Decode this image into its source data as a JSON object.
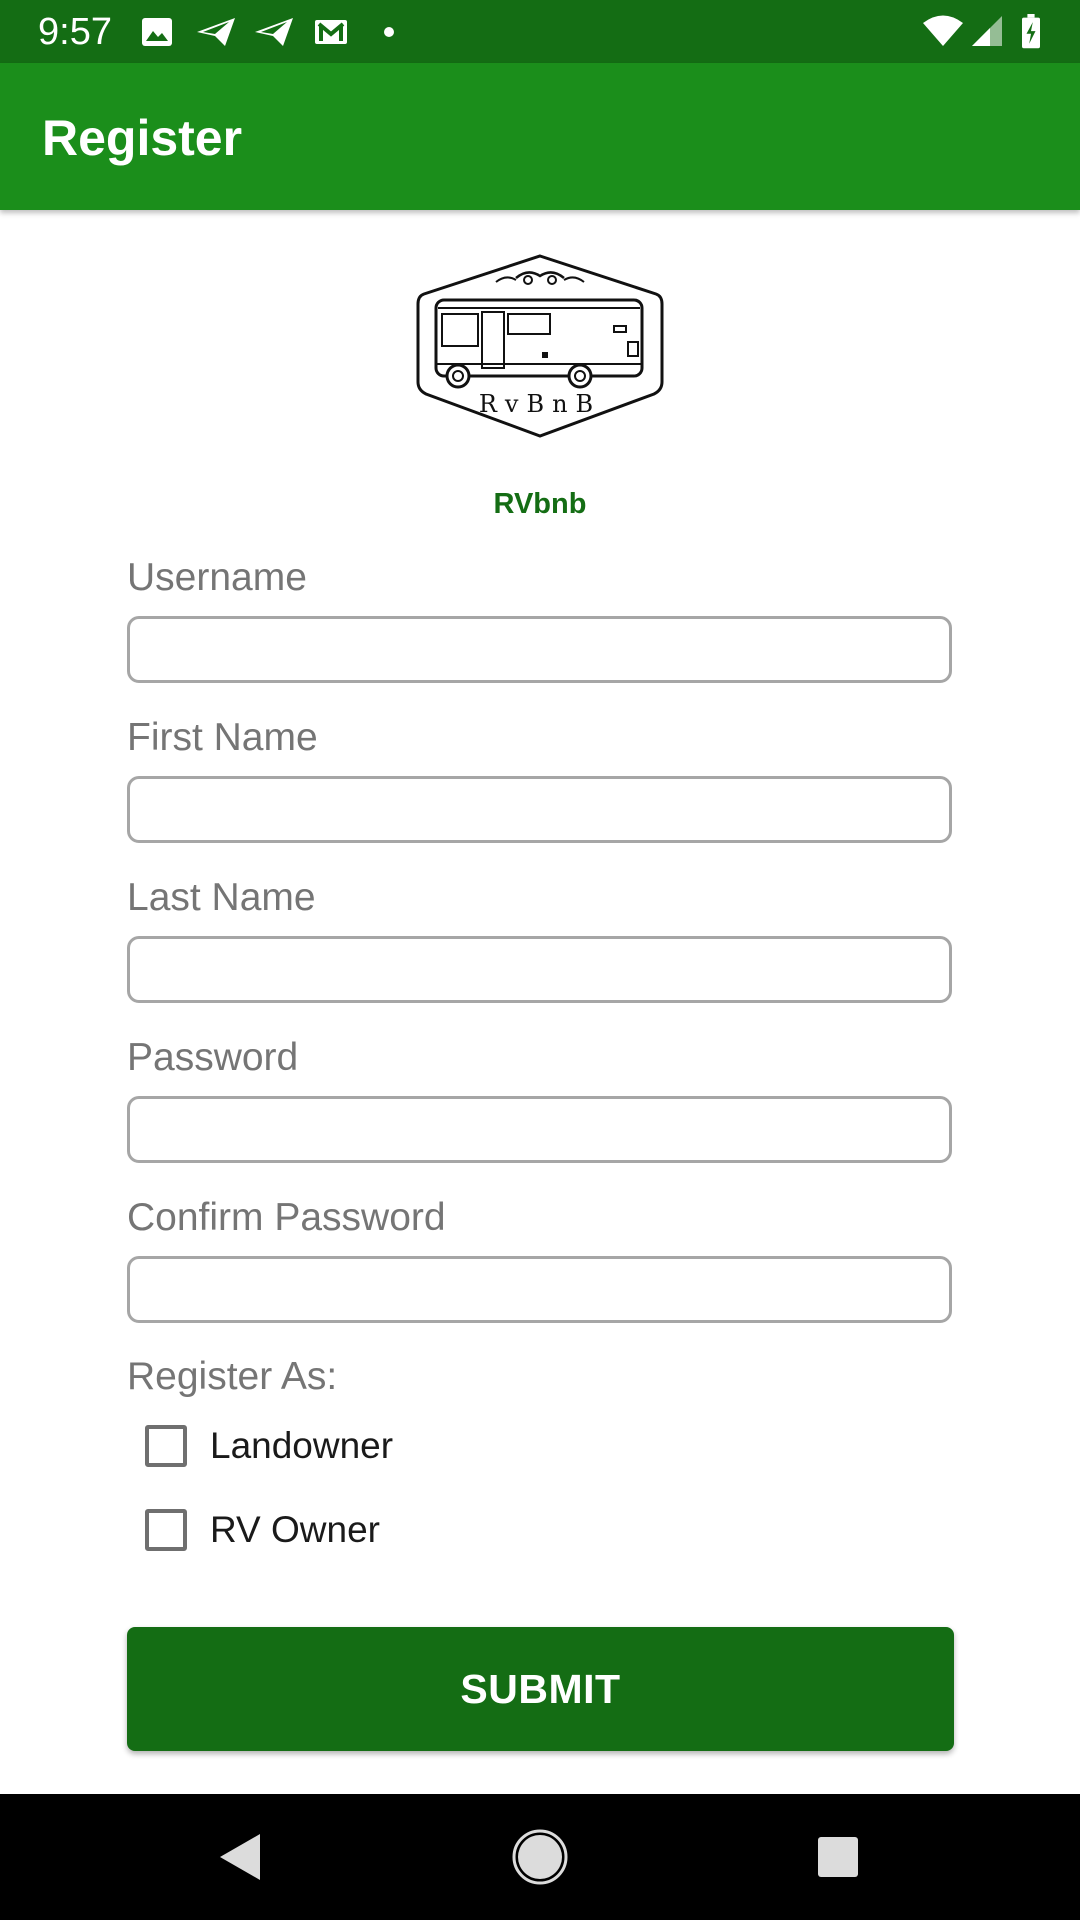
{
  "status_bar": {
    "time": "9:57",
    "left_icons": [
      "image-icon",
      "send-icon",
      "send-icon",
      "gmail-icon",
      "dot-icon"
    ],
    "right_icons": [
      "wifi-icon",
      "cell-signal-icon",
      "battery-charging-icon"
    ]
  },
  "app_bar": {
    "title": "Register"
  },
  "logo": {
    "text": "RvBnB",
    "icon": "rv-camper-logo"
  },
  "brand": {
    "name": "RVbnb"
  },
  "form": {
    "username": {
      "label": "Username",
      "value": ""
    },
    "first_name": {
      "label": "First Name",
      "value": ""
    },
    "last_name": {
      "label": "Last Name",
      "value": ""
    },
    "password": {
      "label": "Password",
      "value": ""
    },
    "confirm_password": {
      "label": "Confirm Password",
      "value": ""
    },
    "register_as": {
      "label": "Register As:",
      "options": [
        {
          "label": "Landowner",
          "checked": false
        },
        {
          "label": "RV Owner",
          "checked": false
        }
      ]
    },
    "submit_label": "SUBMIT"
  },
  "nav_bar": {
    "buttons": [
      "back-icon",
      "home-icon",
      "recents-icon"
    ]
  },
  "colors": {
    "status_bar": "#146d14",
    "app_bar": "#1b8e1b",
    "accent": "#146d14",
    "label": "#757575"
  }
}
